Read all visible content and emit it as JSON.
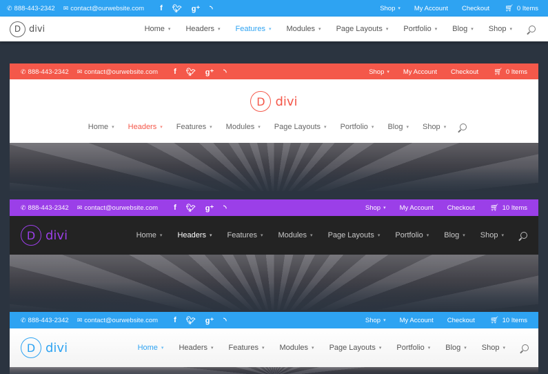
{
  "contact": {
    "phone": "888-443-2342",
    "email": "contact@ourwebsite.com",
    "phone_icon": "phone-icon",
    "email_icon": "envelope-icon"
  },
  "social": {
    "facebook": "f",
    "twitter": "t",
    "googleplus": "g+",
    "rss": "rss"
  },
  "topbar_links": {
    "shop": "Shop",
    "account": "My Account",
    "checkout": "Checkout"
  },
  "logo": {
    "mark": "D",
    "word": "divi"
  },
  "menu": {
    "home": "Home",
    "headers": "Headers",
    "features": "Features",
    "modules": "Modules",
    "page_layouts": "Page Layouts",
    "portfolio": "Portfolio",
    "blog": "Blog",
    "shop": "Shop"
  },
  "sections": {
    "s1": {
      "accent": "#2ea3f2",
      "cart": "0 Items",
      "active": "Features"
    },
    "s2": {
      "accent": "#f4584a",
      "cart": "0 Items",
      "active": "Headers"
    },
    "s3": {
      "accent": "#9b3fe8",
      "cart": "10 Items",
      "active": "Headers"
    },
    "s4": {
      "accent": "#2ea3f2",
      "cart": "10 Items",
      "active": "Home"
    }
  }
}
